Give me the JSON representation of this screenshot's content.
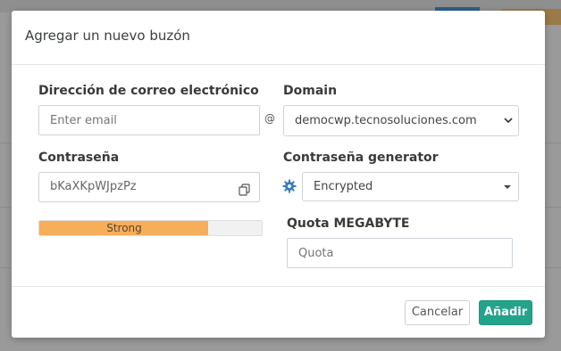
{
  "modal": {
    "title": "Agregar un nuevo buzón",
    "email_label": "Dirección de correo electrónico",
    "email_placeholder": "Enter email",
    "at_symbol": "@",
    "domain_label": "Domain",
    "domain_value": "democwp.tecnosoluciones.com",
    "password_label": "Contraseña",
    "password_value": "bKaXKpWJpzPz",
    "generator_label": "Contraseña generator",
    "generator_value": "Encrypted",
    "strength_text": "Strong",
    "strength_fraction": 0.76,
    "quota_label": "Quota MEGABYTE",
    "quota_placeholder": "Quota",
    "cancel_label": "Cancelar",
    "add_label": "Añadir"
  },
  "colors": {
    "strength_bar": "#f6ae59",
    "primary_button": "#23a48a",
    "gear_icon": "#3a7bbf"
  },
  "icons": {
    "copy": "copy-icon",
    "gear": "gear-icon",
    "chevron": "chevron-down-icon"
  }
}
